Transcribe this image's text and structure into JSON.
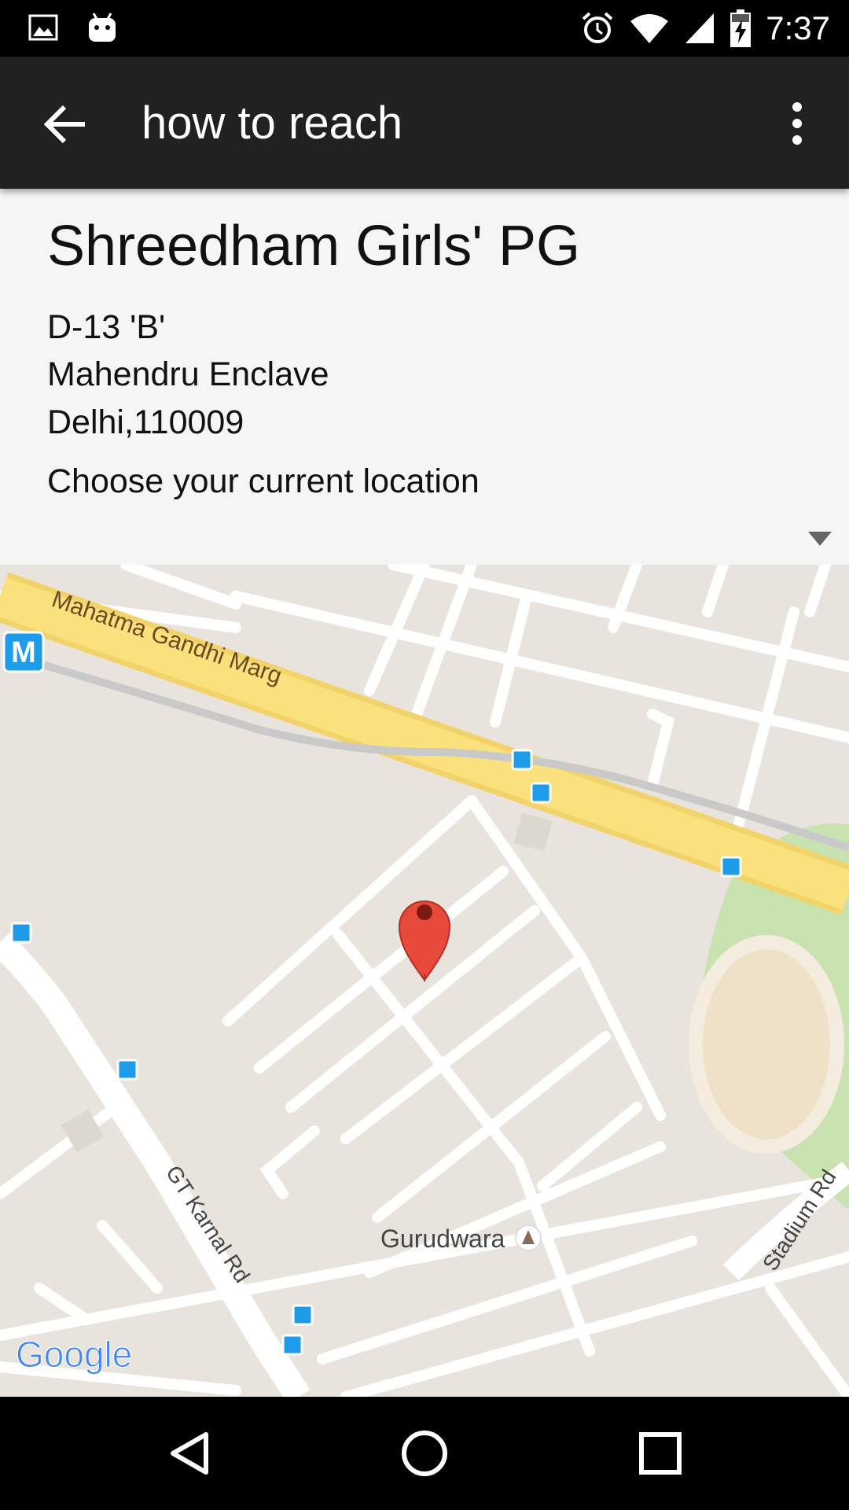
{
  "status_bar": {
    "time": "7:37",
    "left_icons": [
      "image-notification-icon",
      "android-notification-icon"
    ],
    "right_icons": [
      "alarm-icon",
      "wifi-icon",
      "signal-icon",
      "battery-charging-icon"
    ]
  },
  "app_bar": {
    "title": "how to reach",
    "back_icon": "arrow-back-icon",
    "menu_icon": "more-vert-icon"
  },
  "place": {
    "name": "Shreedham Girls' PG",
    "address_line1": "D-13 'B'",
    "address_line2": "Mahendru Enclave",
    "address_line3": "Delhi,110009"
  },
  "location_select": {
    "value": "Choose your current location"
  },
  "map": {
    "labels": {
      "road_main": "Mahatma Gandhi Marg",
      "road_gt": "GT Karnal Rd",
      "road_stadium": "Stadium Rd",
      "poi_gurudwara": "Gurudwara",
      "metro": "M",
      "logo": "Google"
    },
    "colors": {
      "land": "#e8e4dd",
      "major_road": "#f8dc6f",
      "minor_road": "#ffffff",
      "park": "#c9e3b0",
      "marker": "#e7493b",
      "metro": "#1e9be9"
    }
  },
  "nav_bar": {
    "buttons": [
      "back-nav-icon",
      "home-nav-icon",
      "recents-nav-icon"
    ]
  }
}
